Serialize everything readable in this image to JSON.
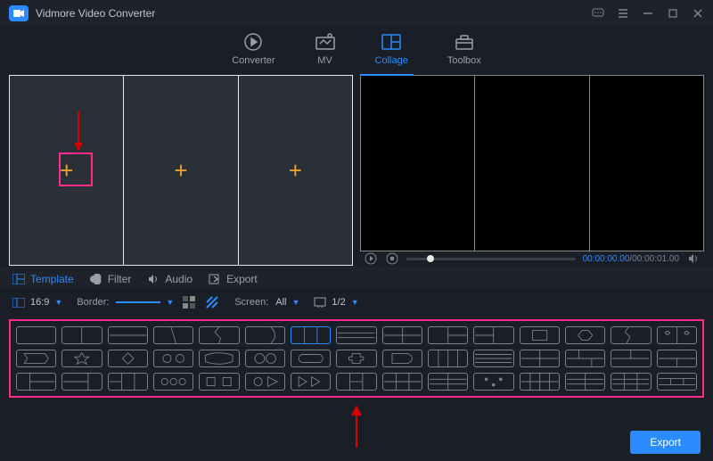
{
  "app": {
    "title": "Vidmore Video Converter"
  },
  "tabs": {
    "converter": "Converter",
    "mv": "MV",
    "collage": "Collage",
    "toolbox": "Toolbox"
  },
  "subtabs": {
    "template": "Template",
    "filter": "Filter",
    "audio": "Audio",
    "export": "Export"
  },
  "options": {
    "ratio": "16:9",
    "border_label": "Border:",
    "screen_label": "Screen:",
    "screen_value": "All",
    "zoom_value": "1/2"
  },
  "player": {
    "current": "00:00:00.00",
    "total": "00:00:01.00"
  },
  "footer": {
    "export": "Export"
  }
}
